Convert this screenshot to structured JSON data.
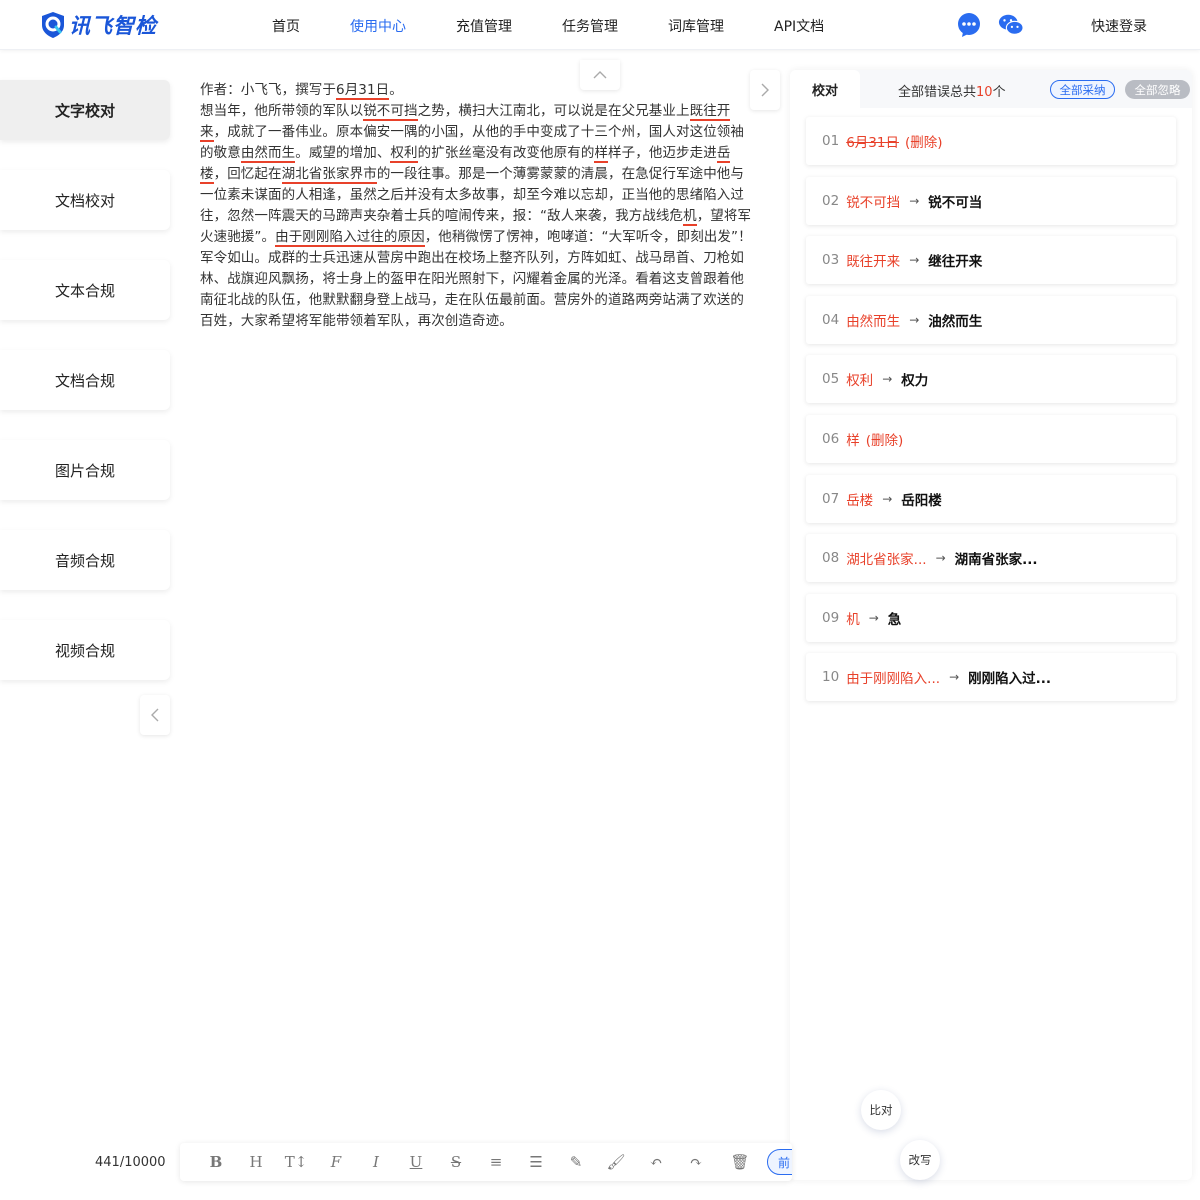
{
  "header": {
    "logo_text": "讯飞智检",
    "nav": [
      "首页",
      "使用中心",
      "充值管理",
      "任务管理",
      "词库管理",
      "API文档"
    ],
    "nav_active_index": 1,
    "login": "快速登录",
    "icons": [
      "chat-bubble-icon",
      "wechat-icon"
    ]
  },
  "sidebar": {
    "items": [
      "文字校对",
      "文档校对",
      "文本合规",
      "文档合规",
      "图片合规",
      "音频合规",
      "视频合规"
    ],
    "active_index": 0
  },
  "editor": {
    "segments": [
      [
        "作者：小飞飞，撰写于",
        false
      ],
      [
        "6月31日",
        true
      ],
      [
        "。",
        false
      ],
      [
        "\n",
        false
      ],
      [
        "想当年，他所带领的军队以",
        false
      ],
      [
        "锐不可挡",
        true
      ],
      [
        "之势，横扫大江南北，可以说是在父兄基业上",
        false
      ],
      [
        "既往开来",
        true
      ],
      [
        "，成就了一番伟业。原本偏安一隅的小国，从他的手中变成了十三个州，国人对这位领袖的敬意",
        false
      ],
      [
        "由然而生",
        true
      ],
      [
        "。威望的增加、",
        false
      ],
      [
        "权利",
        true
      ],
      [
        "的扩张丝毫没有改变他原有的",
        false
      ],
      [
        "样",
        true
      ],
      [
        "样子，他迈步走进",
        false
      ],
      [
        "岳楼",
        true
      ],
      [
        "，回忆起在",
        false
      ],
      [
        "湖北省张家界市",
        true
      ],
      [
        "的一段往事。那是一个薄雾蒙蒙的清晨，在急促行军途中他与一位素未谋面的人相逢，虽然之后并没有太多故事，却至今难以忘却，正当他的思绪陷入过往，忽然一阵震天的马蹄声夹杂着士兵的喧闹传来，报：“敌人来袭，我方战线危",
        false
      ],
      [
        "机",
        true
      ],
      [
        "，望将军火速驰援”。",
        false
      ],
      [
        "由于刚刚陷入过往的原因",
        true
      ],
      [
        "，他稍微愣了愣神，咆哮道：“大军听令，即刻出发”！军令如山。成群的士兵迅速从营房中跑出在校场上整齐队列，方阵如虹、战马昂首、刀枪如林、战旗迎风飘扬，将士身上的盔甲在阳光照射下，闪耀着金属的光泽。看着这支曾跟着他南征北战的队伍，他默默翻身登上战马，走在队伍最前面。营房外的道路两旁站满了欢送的百姓，大家希望将军能带领着军队，再次创造奇迹。",
        false
      ]
    ]
  },
  "panel": {
    "tab": "校对",
    "total_prefix": "全部错误总共",
    "total_count": "10",
    "total_suffix": "个",
    "accept_all": "全部采纳",
    "ignore_all": "全部忽略",
    "errors": [
      {
        "idx": "01",
        "word": "6月31日",
        "fix": "",
        "del": "(删除)",
        "strike": true
      },
      {
        "idx": "02",
        "word": "锐不可挡",
        "fix": "锐不可当",
        "del": "",
        "strike": false
      },
      {
        "idx": "03",
        "word": "既往开来",
        "fix": "继往开来",
        "del": "",
        "strike": false
      },
      {
        "idx": "04",
        "word": "由然而生",
        "fix": "油然而生",
        "del": "",
        "strike": false
      },
      {
        "idx": "05",
        "word": "权利",
        "fix": "权力",
        "del": "",
        "strike": false
      },
      {
        "idx": "06",
        "word": "样",
        "fix": "",
        "del": "(删除)",
        "strike": false
      },
      {
        "idx": "07",
        "word": "岳楼",
        "fix": "岳阳楼",
        "del": "",
        "strike": false
      },
      {
        "idx": "08",
        "word": "湖北省张家...",
        "fix": "湖南省张家...",
        "del": "",
        "strike": false
      },
      {
        "idx": "09",
        "word": "机",
        "fix": "急",
        "del": "",
        "strike": false
      },
      {
        "idx": "10",
        "word": "由于刚刚陷入...",
        "fix": "刚刚陷入过...",
        "del": "",
        "strike": false
      }
    ]
  },
  "float": {
    "compare": "比对",
    "rewrite": "改写"
  },
  "footer": {
    "counter": "441/10000",
    "tools": [
      {
        "glyph": "B",
        "name": "bold-icon"
      },
      {
        "glyph": "H",
        "name": "heading-icon"
      },
      {
        "glyph": "T↕",
        "name": "font-size-icon"
      },
      {
        "glyph": "F",
        "name": "font-family-icon"
      },
      {
        "glyph": "I",
        "name": "italic-icon"
      },
      {
        "glyph": "U",
        "name": "underline-icon"
      },
      {
        "glyph": "S",
        "name": "strikethrough-icon"
      },
      {
        "glyph": "≡",
        "name": "indent-icon"
      },
      {
        "glyph": "☰",
        "name": "line-height-icon"
      },
      {
        "glyph": "✎",
        "name": "highlight-pen-icon"
      },
      {
        "glyph": "🖌",
        "name": "brush-icon"
      },
      {
        "glyph": "↶",
        "name": "undo-icon"
      },
      {
        "glyph": "↷",
        "name": "redo-icon"
      },
      {
        "glyph": "🗑",
        "name": "trash-icon"
      }
    ],
    "pill_label": "前"
  },
  "colors": {
    "accent": "#2a6cf0",
    "error": "#e8412a"
  }
}
